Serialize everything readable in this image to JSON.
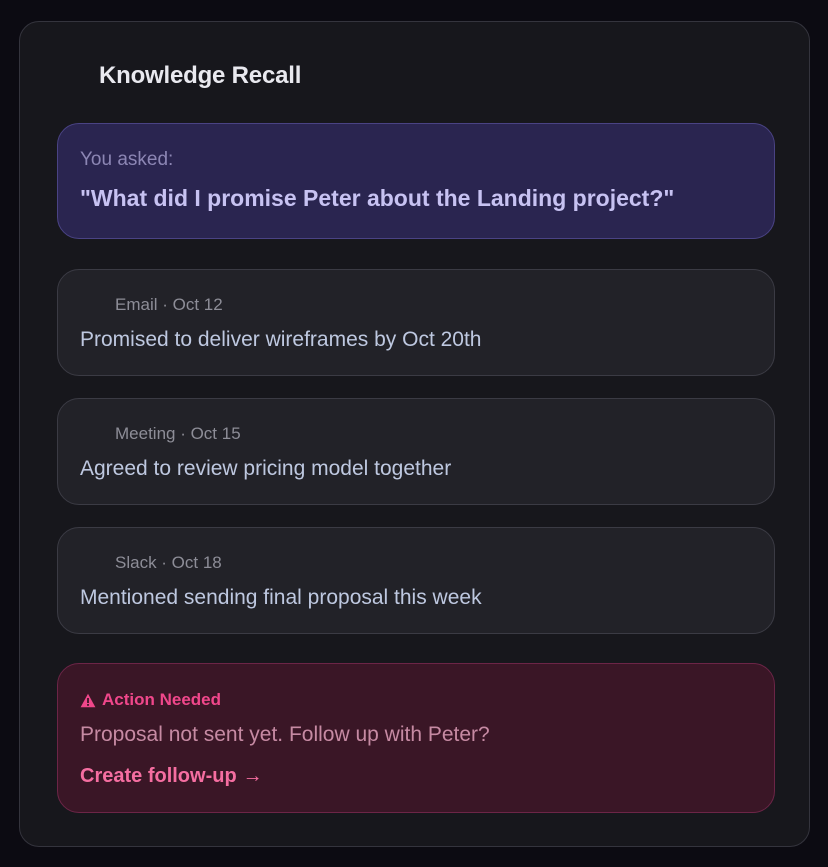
{
  "panel": {
    "title": "Knowledge Recall"
  },
  "query": {
    "label": "You asked:",
    "text": "\"What did I promise Peter about the Landing project?\""
  },
  "memories": [
    {
      "source": "Email",
      "date": "Oct 12",
      "meta": "Email · Oct 12",
      "text": "Promised to deliver wireframes by Oct 20th"
    },
    {
      "source": "Meeting",
      "date": "Oct 15",
      "meta": "Meeting · Oct 15",
      "text": "Agreed to review pricing model together"
    },
    {
      "source": "Slack",
      "date": "Oct 18",
      "meta": "Slack · Oct 18",
      "text": "Mentioned sending final proposal this week"
    }
  ],
  "action": {
    "heading": "Action Needed",
    "icon": "warning-triangle-icon",
    "message": "Proposal not sent yet. Follow up with Peter?",
    "link_label": "Create follow-up",
    "link_arrow": "→"
  },
  "colors": {
    "background": "#0c0b12",
    "panel": "#17171c",
    "query_bg": "#2a2550",
    "query_text": "#c7c2f2",
    "memory_bg": "#222228",
    "memory_text": "#bec8e0",
    "action_bg": "#3a1626",
    "action_accent": "#f0478b"
  }
}
